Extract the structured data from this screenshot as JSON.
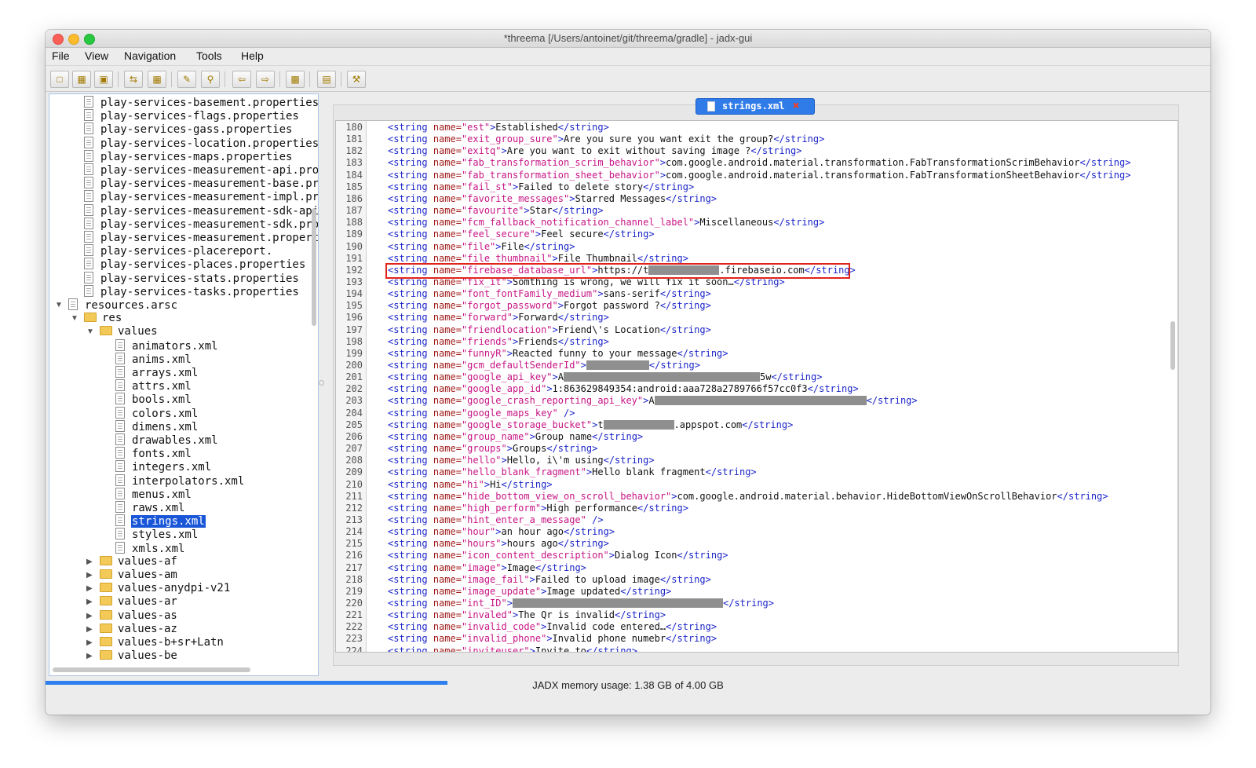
{
  "window": {
    "title": "*threema [/Users/antoinet/git/threema/gradle] - jadx-gui"
  },
  "menubar": {
    "items": [
      {
        "label": "File"
      },
      {
        "label": "View"
      },
      {
        "label": "Navigation"
      },
      {
        "label": "Tools"
      },
      {
        "label": "Help"
      }
    ]
  },
  "toolbar": {
    "buttons": [
      {
        "icon": "open-folder-icon"
      },
      {
        "icon": "save-all-icon"
      },
      {
        "icon": "export-icon"
      },
      {
        "icon": "sync-icon"
      },
      {
        "icon": "flatten-icon"
      },
      {
        "icon": "text-search-icon"
      },
      {
        "icon": "class-search-icon"
      },
      {
        "icon": "back-arrow-icon"
      },
      {
        "icon": "forward-arrow-icon"
      },
      {
        "icon": "deobfuscation-icon"
      },
      {
        "icon": "log-viewer-icon"
      },
      {
        "icon": "preferences-icon"
      }
    ]
  },
  "tree": {
    "items": [
      {
        "label": "play-services-basement.properties",
        "type": "file",
        "depth": 2
      },
      {
        "label": "play-services-flags.properties",
        "type": "file",
        "depth": 2
      },
      {
        "label": "play-services-gass.properties",
        "type": "file",
        "depth": 2
      },
      {
        "label": "play-services-location.properties",
        "type": "file",
        "depth": 2
      },
      {
        "label": "play-services-maps.properties",
        "type": "file",
        "depth": 2
      },
      {
        "label": "play-services-measurement-api.pro",
        "type": "file",
        "depth": 2
      },
      {
        "label": "play-services-measurement-base.pr",
        "type": "file",
        "depth": 2
      },
      {
        "label": "play-services-measurement-impl.pr",
        "type": "file",
        "depth": 2
      },
      {
        "label": "play-services-measurement-sdk-api",
        "type": "file",
        "depth": 2
      },
      {
        "label": "play-services-measurement-sdk.pro",
        "type": "file",
        "depth": 2
      },
      {
        "label": "play-services-measurement.propert",
        "type": "file",
        "depth": 2
      },
      {
        "label": "play-services-placereport.",
        "type": "file",
        "depth": 2
      },
      {
        "label": "play-services-places.properties",
        "type": "file",
        "depth": 2
      },
      {
        "label": "play-services-stats.properties",
        "type": "file",
        "depth": 2
      },
      {
        "label": "play-services-tasks.properties",
        "type": "file",
        "depth": 2
      },
      {
        "label": "resources.arsc",
        "type": "file",
        "depth": 1,
        "caret": "open"
      },
      {
        "label": "res",
        "type": "folder",
        "depth": 2,
        "caret": "open"
      },
      {
        "label": "values",
        "type": "folder",
        "depth": 3,
        "caret": "open"
      },
      {
        "label": "animators.xml",
        "type": "file",
        "depth": 4
      },
      {
        "label": "anims.xml",
        "type": "file",
        "depth": 4
      },
      {
        "label": "arrays.xml",
        "type": "file",
        "depth": 4
      },
      {
        "label": "attrs.xml",
        "type": "file",
        "depth": 4
      },
      {
        "label": "bools.xml",
        "type": "file",
        "depth": 4
      },
      {
        "label": "colors.xml",
        "type": "file",
        "depth": 4
      },
      {
        "label": "dimens.xml",
        "type": "file",
        "depth": 4
      },
      {
        "label": "drawables.xml",
        "type": "file",
        "depth": 4
      },
      {
        "label": "fonts.xml",
        "type": "file",
        "depth": 4
      },
      {
        "label": "integers.xml",
        "type": "file",
        "depth": 4
      },
      {
        "label": "interpolators.xml",
        "type": "file",
        "depth": 4
      },
      {
        "label": "menus.xml",
        "type": "file",
        "depth": 4
      },
      {
        "label": "raws.xml",
        "type": "file",
        "depth": 4
      },
      {
        "label": "strings.xml",
        "type": "file",
        "depth": 4,
        "selected": true
      },
      {
        "label": "styles.xml",
        "type": "file",
        "depth": 4
      },
      {
        "label": "xmls.xml",
        "type": "file",
        "depth": 4
      },
      {
        "label": "values-af",
        "type": "folder",
        "depth": 3,
        "caret": "closed"
      },
      {
        "label": "values-am",
        "type": "folder",
        "depth": 3,
        "caret": "closed"
      },
      {
        "label": "values-anydpi-v21",
        "type": "folder",
        "depth": 3,
        "caret": "closed"
      },
      {
        "label": "values-ar",
        "type": "folder",
        "depth": 3,
        "caret": "closed"
      },
      {
        "label": "values-as",
        "type": "folder",
        "depth": 3,
        "caret": "closed"
      },
      {
        "label": "values-az",
        "type": "folder",
        "depth": 3,
        "caret": "closed"
      },
      {
        "label": "values-b+sr+Latn",
        "type": "folder",
        "depth": 3,
        "caret": "closed"
      },
      {
        "label": "values-be",
        "type": "folder",
        "depth": 3,
        "caret": "closed"
      }
    ]
  },
  "editor": {
    "tab": {
      "label": "strings.xml",
      "icon": "file-icon",
      "close_icon": "close-icon"
    },
    "highlighted_line": "192",
    "lines": [
      {
        "no": "180",
        "name": "est",
        "pre": "Established",
        "post": ""
      },
      {
        "no": "181",
        "name": "exit_group_sure",
        "pre": "Are you sure you want exit the group?",
        "post": ""
      },
      {
        "no": "182",
        "name": "exitq",
        "pre": "Are you want to exit without saving image ?",
        "post": ""
      },
      {
        "no": "183",
        "name": "fab_transformation_scrim_behavior",
        "pre": "com.google.android.material.transformation.FabTransformationScrimBehavior",
        "post": ""
      },
      {
        "no": "184",
        "name": "fab_transformation_sheet_behavior",
        "pre": "com.google.android.material.transformation.FabTransformationSheetBehavior",
        "post": ""
      },
      {
        "no": "185",
        "name": "fail_st",
        "pre": "Failed to delete story",
        "post": ""
      },
      {
        "no": "186",
        "name": "favorite_messages",
        "pre": "Starred Messages",
        "post": ""
      },
      {
        "no": "187",
        "name": "favourite",
        "pre": "Star",
        "post": ""
      },
      {
        "no": "188",
        "name": "fcm_fallback_notification_channel_label",
        "pre": "Miscellaneous",
        "post": ""
      },
      {
        "no": "189",
        "name": "feel_secure",
        "pre": "Feel secure",
        "post": ""
      },
      {
        "no": "190",
        "name": "file",
        "pre": "File",
        "post": ""
      },
      {
        "no": "191",
        "name": "file_thumbnail",
        "pre": "File Thumbnail",
        "post": ""
      },
      {
        "no": "192",
        "name": "firebase_database_url",
        "pre": "https://t",
        "redact": 90,
        "post": ".firebaseio.com"
      },
      {
        "no": "193",
        "name": "fix_it",
        "pre": "Somthing is wrong, we will fix it soon…",
        "post": ""
      },
      {
        "no": "194",
        "name": "font_fontFamily_medium",
        "pre": "sans-serif",
        "post": ""
      },
      {
        "no": "195",
        "name": "forgot_password",
        "pre": "Forgot password ?",
        "post": ""
      },
      {
        "no": "196",
        "name": "forward",
        "pre": "Forward",
        "post": ""
      },
      {
        "no": "197",
        "name": "friendlocation",
        "pre": "Friend\\'s Location",
        "post": ""
      },
      {
        "no": "198",
        "name": "friends",
        "pre": "Friends",
        "post": ""
      },
      {
        "no": "199",
        "name": "funnyR",
        "pre": "Reacted funny to your message",
        "post": ""
      },
      {
        "no": "200",
        "name": "gcm_defaultSenderId",
        "pre": "",
        "redact": 80,
        "post": ""
      },
      {
        "no": "201",
        "name": "google_api_key",
        "pre": "A",
        "redact": 250,
        "post": "5w"
      },
      {
        "no": "202",
        "name": "google_app_id",
        "pre": "1:863629849354:android:aaa728a2789766f57cc0f3",
        "post": ""
      },
      {
        "no": "203",
        "name": "google_crash_reporting_api_key",
        "pre": "A",
        "redact": 270,
        "post": ""
      },
      {
        "no": "204",
        "name": "google_maps_key",
        "pre": "",
        "post": "",
        "selfclose": true
      },
      {
        "no": "205",
        "name": "google_storage_bucket",
        "pre": "t",
        "redact": 90,
        "post": ".appspot.com"
      },
      {
        "no": "206",
        "name": "group_name",
        "pre": "Group name",
        "post": ""
      },
      {
        "no": "207",
        "name": "groups",
        "pre": "Groups",
        "post": ""
      },
      {
        "no": "208",
        "name": "hello",
        "pre": "Hello, i\\'m using",
        "post": ""
      },
      {
        "no": "209",
        "name": "hello_blank_fragment",
        "pre": "Hello blank fragment",
        "post": ""
      },
      {
        "no": "210",
        "name": "hi",
        "pre": "Hi",
        "post": ""
      },
      {
        "no": "211",
        "name": "hide_bottom_view_on_scroll_behavior",
        "pre": "com.google.android.material.behavior.HideBottomViewOnScrollBehavior",
        "post": ""
      },
      {
        "no": "212",
        "name": "high_perform",
        "pre": "High performance",
        "post": ""
      },
      {
        "no": "213",
        "name": "hint_enter_a_message",
        "pre": "",
        "post": "",
        "selfclose": true
      },
      {
        "no": "214",
        "name": "hour",
        "pre": "an hour ago",
        "post": ""
      },
      {
        "no": "215",
        "name": "hours",
        "pre": "hours ago",
        "post": ""
      },
      {
        "no": "216",
        "name": "icon_content_description",
        "pre": "Dialog Icon",
        "post": ""
      },
      {
        "no": "217",
        "name": "image",
        "pre": "Image",
        "post": ""
      },
      {
        "no": "218",
        "name": "image_fail",
        "pre": "Failed to upload image",
        "post": ""
      },
      {
        "no": "219",
        "name": "image_update",
        "pre": "Image updated",
        "post": ""
      },
      {
        "no": "220",
        "name": "int_ID",
        "pre": "",
        "redact": 268,
        "post": ""
      },
      {
        "no": "221",
        "name": "invaled",
        "pre": "The Qr is invalid",
        "post": ""
      },
      {
        "no": "222",
        "name": "invalid_code",
        "pre": "Invalid code entered…",
        "post": ""
      },
      {
        "no": "223",
        "name": "invalid_phone",
        "pre": "Invalid phone numebr",
        "post": ""
      },
      {
        "no": "224",
        "name": "inviteuser",
        "pre": "Invite to",
        "post": ""
      }
    ]
  },
  "status": {
    "memory_label": "JADX memory usage: 1.38 GB of 4.00 GB",
    "memory_fraction": 0.345
  },
  "colors": {
    "accent": "#2f7be8",
    "selection": "#1a56d8",
    "highlight_box": "#e0231b",
    "xml_tag": "#1a24c8",
    "xml_attr_name": "#a01a1a",
    "xml_attr_value": "#c71585"
  }
}
